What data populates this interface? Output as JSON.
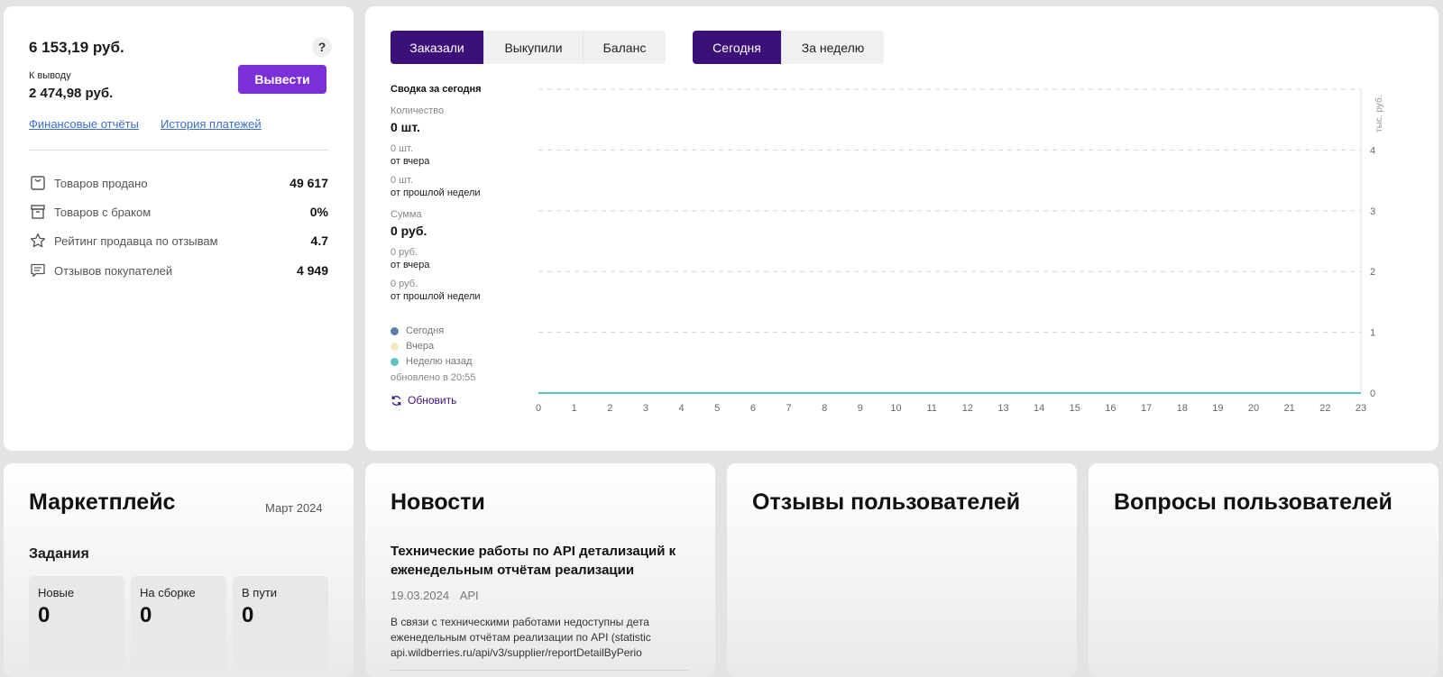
{
  "balance": {
    "total": "6 153,19 руб.",
    "help_icon": "?",
    "withdraw_label": "К выводу",
    "withdraw_amount": "2 474,98 руб.",
    "withdraw_button": "Вывести",
    "links": [
      "Финансовые отчёты",
      "История платежей"
    ],
    "stats": [
      {
        "icon": "bag-icon",
        "label": "Товаров продано",
        "value": "49 617"
      },
      {
        "icon": "box-icon",
        "label": "Товаров с браком",
        "value": "0%"
      },
      {
        "icon": "star-icon",
        "label": "Рейтинг продавца по отзывам",
        "value": "4.7"
      },
      {
        "icon": "chat-icon",
        "label": "Отзывов покупателей",
        "value": "4 949"
      }
    ]
  },
  "chart_panel": {
    "type_tabs": [
      "Заказали",
      "Выкупили",
      "Баланс"
    ],
    "active_type_tab": "Заказали",
    "period_tabs": [
      "Сегодня",
      "За неделю"
    ],
    "active_period_tab": "Сегодня",
    "summary_title": "Сводка за сегодня",
    "quantity_label": "Количество",
    "quantity_value": "0 шт.",
    "quantity_yesterday_value": "0 шт.",
    "quantity_yesterday_label": "от вчера",
    "quantity_week_value": "0 шт.",
    "quantity_week_label": "от прошлой недели",
    "sum_label": "Сумма",
    "sum_value": "0 руб.",
    "sum_yesterday_value": "0 руб.",
    "sum_yesterday_label": "от вчера",
    "sum_week_value": "0 руб.",
    "sum_week_label": "от прошлой недели",
    "updated": "обновлено в 20:55",
    "refresh_label": "Обновить",
    "refresh_icon": "refresh-icon"
  },
  "chart_data": {
    "type": "line",
    "x": [
      0,
      1,
      2,
      3,
      4,
      5,
      6,
      7,
      8,
      9,
      10,
      11,
      12,
      13,
      14,
      15,
      16,
      17,
      18,
      19,
      20,
      21,
      22,
      23
    ],
    "series": [
      {
        "name": "Сегодня",
        "color": "#5a7fa6",
        "values": [
          0,
          0,
          0,
          0,
          0,
          0,
          0,
          0,
          0,
          0,
          0,
          0,
          0,
          0,
          0,
          0,
          0,
          0,
          0,
          0,
          0,
          0,
          0,
          0
        ]
      },
      {
        "name": "Вчера",
        "color": "#f6e7c4",
        "values": [
          0,
          0,
          0,
          0,
          0,
          0,
          0,
          0,
          0,
          0,
          0,
          0,
          0,
          0,
          0,
          0,
          0,
          0,
          0,
          0,
          0,
          0,
          0,
          0
        ]
      },
      {
        "name": "Неделю назад",
        "color": "#5cc4c4",
        "values": [
          0,
          0,
          0,
          0,
          0,
          0,
          0,
          0,
          0,
          0,
          0,
          0,
          0,
          0,
          0,
          0,
          0,
          0,
          0,
          0,
          0,
          0,
          0,
          0
        ]
      }
    ],
    "y_ticks": [
      0,
      1,
      2,
      3,
      4
    ],
    "ylabel": "тыс. руб.",
    "ylim": [
      0,
      5
    ],
    "grid": true,
    "legend_position": "left"
  },
  "marketplace": {
    "title": "Маркетплейс",
    "month": "Март 2024",
    "tasks_title": "Задания",
    "tasks": [
      {
        "label": "Новые",
        "count": "0"
      },
      {
        "label": "На сборке",
        "count": "0"
      },
      {
        "label": "В пути",
        "count": "0"
      }
    ]
  },
  "news": {
    "title": "Новости",
    "headline": "Технические работы по API детализаций к еженедельным отчётам реализации",
    "date": "19.03.2024",
    "tag": "API",
    "body_lines": [
      "В связи с техническими работами недоступны дета",
      "еженедельным отчётам реализации по API (statistic",
      "api.wildberries.ru/api/v3/supplier/reportDetailByPerio"
    ]
  },
  "reviews": {
    "title": "Отзывы пользователей"
  },
  "questions": {
    "title": "Вопросы пользователей"
  },
  "colors": {
    "accent": "#7b2fd8",
    "active_tab": "#3b1078",
    "link": "#3b6fc9"
  }
}
